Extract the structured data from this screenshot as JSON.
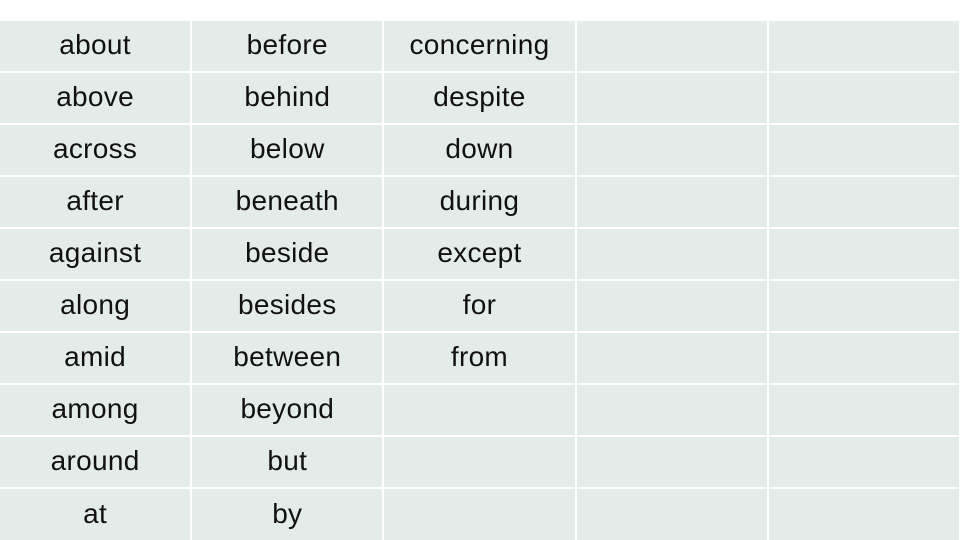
{
  "table": {
    "columns": [
      [
        "about",
        "above",
        "across",
        "after",
        "against",
        "along",
        "amid",
        "among",
        "around",
        "at"
      ],
      [
        "before",
        "behind",
        "below",
        "beneath",
        "beside",
        "besides",
        "between",
        "beyond",
        "but",
        "by"
      ],
      [
        "concerning",
        "despite",
        "down",
        "during",
        "except",
        "for",
        "from",
        "",
        "",
        ""
      ],
      [
        "",
        "",
        "",
        "",
        "",
        "",
        "",
        "",
        "",
        ""
      ],
      [
        "",
        "",
        "",
        "",
        "",
        "",
        "",
        "",
        "",
        ""
      ]
    ]
  },
  "colors": {
    "cell_background": "#e4ecea",
    "grid_line": "#ffffff",
    "text": "#111111"
  }
}
